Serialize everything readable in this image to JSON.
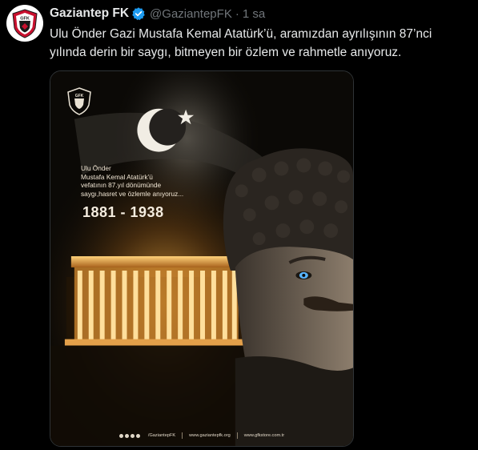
{
  "tweet": {
    "display_name": "Gaziantep FK",
    "handle": "@GaziantepFK",
    "separator": "·",
    "time": "1 sa",
    "text": "Ulu Önder Gazi Mustafa Kemal Atatürk’ü, aramızdan ayrılışının 87’nci\nyılında derin bir saygı, bitmeyen bir özlem ve rahmetle anıyoruz."
  },
  "avatar": {
    "badge_text": "GFK"
  },
  "media": {
    "badge_text": "GFK",
    "caption": "Ulu Önder\nMustafa Kemal Atatürk’ü\nvefatının 87.yıl dönümünde\nsaygı,hasret ve özlemle anıyoruz...",
    "years": "1881 - 1938",
    "footer": {
      "social": "/GaziantepFK",
      "website": "www.gaziantepfk.org",
      "store": "www.gfkstore.com.tr"
    }
  },
  "colors": {
    "background": "#000000",
    "text_primary": "#e7e9ea",
    "text_secondary": "#71767b",
    "verified_blue": "#1d9bf0",
    "club_red": "#c8102e",
    "gold": "#f3b24a"
  }
}
